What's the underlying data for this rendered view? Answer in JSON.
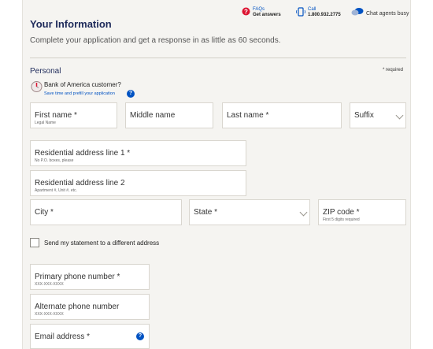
{
  "header": {
    "title": "Your Information",
    "subtitle": "Complete your application and get a response in as little as 60 seconds."
  },
  "help": {
    "faqs_label": "FAQs",
    "faqs_sub": "Get answers",
    "call_label": "Call",
    "call_number": "1.800.932.2775",
    "chat_status": "Chat agents busy"
  },
  "section": {
    "title": "Personal",
    "required_note": "* required"
  },
  "customer": {
    "question": "Bank of America customer?",
    "prefill_link": "Save time and prefill your application"
  },
  "fields": {
    "first_name": {
      "label": "First name *",
      "hint": "Legal Name"
    },
    "middle_name": {
      "label": "Middle name"
    },
    "last_name": {
      "label": "Last name *"
    },
    "suffix": {
      "label": "Suffix"
    },
    "address1": {
      "label": "Residential address line 1 *",
      "hint": "No P.O. boxes, please"
    },
    "address2": {
      "label": "Residential address line 2",
      "hint": "Apartment #, Unit #, etc."
    },
    "city": {
      "label": "City *"
    },
    "state": {
      "label": "State *"
    },
    "zip": {
      "label": "ZIP code *",
      "hint": "First 5 digits required"
    },
    "primary_phone": {
      "label": "Primary phone number *",
      "hint": "XXX-XXX-XXXX"
    },
    "alternate_phone": {
      "label": "Alternate phone number",
      "hint": "XXX-XXX-XXXX"
    },
    "email": {
      "label": "Email address *"
    }
  },
  "statement_checkbox": {
    "label": "Send my statement to a different address"
  },
  "colors": {
    "brand_navy": "#1e2a5a",
    "link_blue": "#0052c2",
    "alert_red": "#dc1431"
  }
}
